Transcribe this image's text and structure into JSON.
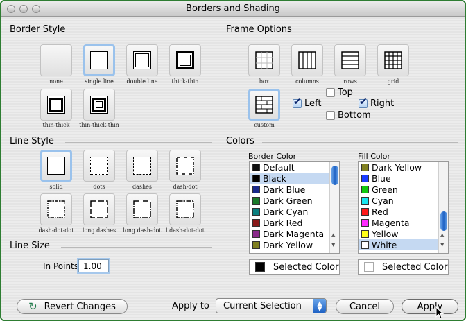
{
  "window": {
    "title": "Borders and Shading"
  },
  "border_style": {
    "heading": "Border Style",
    "options": [
      {
        "label": "none",
        "selected": false
      },
      {
        "label": "single line",
        "selected": true
      },
      {
        "label": "double line",
        "selected": false
      },
      {
        "label": "thick-thin",
        "selected": false
      },
      {
        "label": "thin-thick",
        "selected": false
      },
      {
        "label": "thin-thick-thin",
        "selected": false
      }
    ]
  },
  "frame_options": {
    "heading": "Frame Options",
    "options": [
      {
        "label": "box",
        "selected": false
      },
      {
        "label": "columns",
        "selected": false
      },
      {
        "label": "rows",
        "selected": false
      },
      {
        "label": "grid",
        "selected": false
      },
      {
        "label": "custom",
        "selected": true
      }
    ],
    "sides": {
      "top": "Top",
      "left": "Left",
      "right": "Right",
      "bottom": "Bottom"
    },
    "sides_checked": {
      "top": false,
      "left": true,
      "right": true,
      "bottom": false
    }
  },
  "line_style": {
    "heading": "Line Style",
    "options": [
      {
        "label": "solid",
        "selected": true
      },
      {
        "label": "dots",
        "selected": false
      },
      {
        "label": "dashes",
        "selected": false
      },
      {
        "label": "dash-dot",
        "selected": false
      },
      {
        "label": "dash-dot-dot",
        "selected": false
      },
      {
        "label": "long dashes",
        "selected": false
      },
      {
        "label": "long dash-dot",
        "selected": false
      },
      {
        "label": "l.dash-dot-dot",
        "selected": false
      }
    ]
  },
  "line_size": {
    "heading": "Line Size",
    "label": "In Points",
    "value": "1.00"
  },
  "colors": {
    "heading": "Colors",
    "border_color": {
      "label": "Border Color",
      "items": [
        {
          "name": "Default",
          "swatch": "#111111",
          "selected": false
        },
        {
          "name": "Black",
          "swatch": "#000000",
          "selected": true
        },
        {
          "name": "Dark Blue",
          "swatch": "#1a2a8c",
          "selected": false
        },
        {
          "name": "Dark Green",
          "swatch": "#1a7a2a",
          "selected": false
        },
        {
          "name": "Dark Cyan",
          "swatch": "#0a8080",
          "selected": false
        },
        {
          "name": "Dark Red",
          "swatch": "#8a1a1a",
          "selected": false
        },
        {
          "name": "Dark Magenta",
          "swatch": "#8a2a8a",
          "selected": false
        },
        {
          "name": "Dark Yellow",
          "swatch": "#808020",
          "selected": false
        }
      ],
      "selected_label": "Selected Color",
      "selected_swatch": "#000000"
    },
    "fill_color": {
      "label": "Fill Color",
      "items": [
        {
          "name": "Dark Yellow",
          "swatch": "#808020",
          "selected": false
        },
        {
          "name": "Blue",
          "swatch": "#1a3cff",
          "selected": false
        },
        {
          "name": "Green",
          "swatch": "#11c811",
          "selected": false
        },
        {
          "name": "Cyan",
          "swatch": "#17e6f0",
          "selected": false
        },
        {
          "name": "Red",
          "swatch": "#ff1a1a",
          "selected": false
        },
        {
          "name": "Magenta",
          "swatch": "#ff2aff",
          "selected": false
        },
        {
          "name": "Yellow",
          "swatch": "#ffff1a",
          "selected": false
        },
        {
          "name": "White",
          "swatch": "#ffffff",
          "selected": true
        }
      ],
      "selected_label": "Selected Color",
      "selected_swatch": "#ffffff"
    }
  },
  "footer": {
    "revert_label": "Revert Changes",
    "apply_to_label": "Apply to",
    "apply_to_value": "Current Selection",
    "cancel_label": "Cancel",
    "apply_label": "Apply"
  }
}
